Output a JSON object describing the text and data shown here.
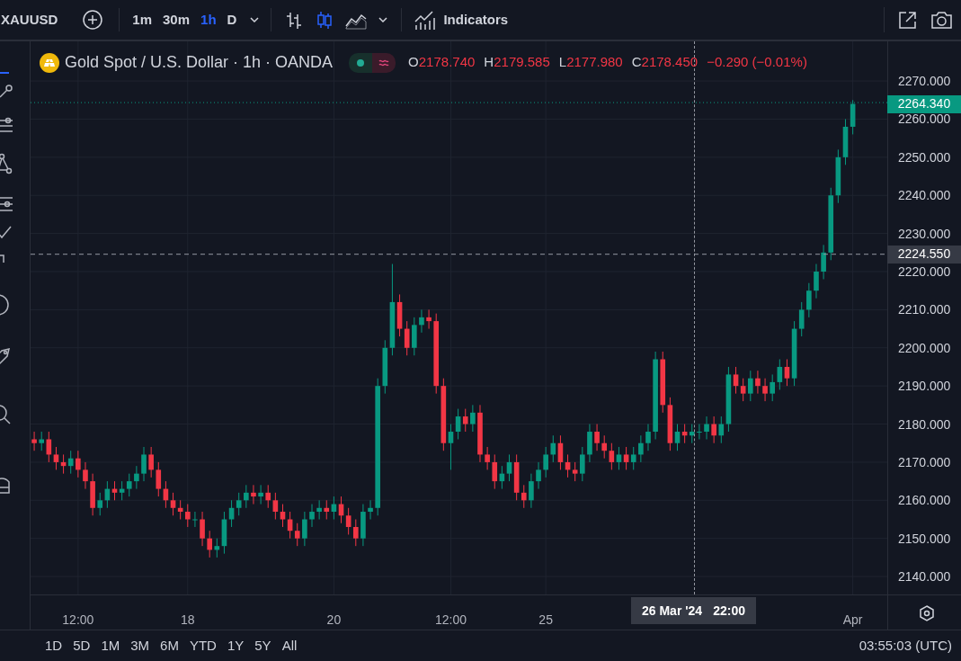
{
  "toolbar": {
    "symbol": "XAUUSD",
    "intervals": [
      {
        "label": "1m",
        "selected": false
      },
      {
        "label": "30m",
        "selected": false
      },
      {
        "label": "1h",
        "selected": true
      },
      {
        "label": "D",
        "selected": false
      }
    ],
    "chart_styles": [
      {
        "kind": "bars",
        "selected": false
      },
      {
        "kind": "candles",
        "selected": true
      },
      {
        "kind": "area",
        "selected": false
      }
    ],
    "indicators_label": "Indicators"
  },
  "legend": {
    "title": "Gold Spot / U.S. Dollar · 1h · OANDA",
    "ohlc": [
      {
        "label": "O",
        "value": "2178.740"
      },
      {
        "label": "H",
        "value": "2179.585"
      },
      {
        "label": "L",
        "value": "2177.980"
      },
      {
        "label": "C",
        "value": "2178.450"
      }
    ],
    "change": "−0.290 (−0.01%)"
  },
  "crosshair": {
    "price": "2224.550",
    "date": "26 Mar '24",
    "time": "22:00"
  },
  "last_price": "2264.340",
  "chart_data": {
    "type": "candlestick",
    "grid": true,
    "ref_lines": [
      {
        "axis": "y",
        "value": 2264.34,
        "color": "#089981"
      },
      {
        "axis": "y",
        "value": 2224.55,
        "color": "#9598a1"
      }
    ],
    "ylim": [
      2135.3,
      2280.4
    ],
    "yticks": [
      {
        "value": 2270,
        "label": "2270.000"
      },
      {
        "value": 2260,
        "label": "2260.000"
      },
      {
        "value": 2250,
        "label": "2250.000"
      },
      {
        "value": 2240,
        "label": "2240.000"
      },
      {
        "value": 2230,
        "label": "2230.000"
      },
      {
        "value": 2220,
        "label": "2220.000"
      },
      {
        "value": 2210,
        "label": "2210.000"
      },
      {
        "value": 2200,
        "label": "2200.000"
      },
      {
        "value": 2190,
        "label": "2190.000"
      },
      {
        "value": 2180,
        "label": "2180.000"
      },
      {
        "value": 2170,
        "label": "2170.000"
      },
      {
        "value": 2160,
        "label": "2160.000"
      },
      {
        "value": 2150,
        "label": "2150.000"
      },
      {
        "value": 2140,
        "label": "2140.000"
      }
    ],
    "categories": [
      null,
      null,
      null,
      null,
      null,
      null,
      "12:00",
      null,
      null,
      null,
      null,
      null,
      null,
      null,
      null,
      null,
      null,
      null,
      null,
      null,
      null,
      "18",
      null,
      null,
      null,
      null,
      null,
      null,
      null,
      null,
      null,
      null,
      null,
      null,
      null,
      null,
      null,
      null,
      null,
      null,
      null,
      "20",
      null,
      null,
      null,
      null,
      null,
      null,
      null,
      null,
      null,
      null,
      null,
      null,
      null,
      null,
      null,
      "12:00",
      null,
      null,
      null,
      null,
      null,
      null,
      null,
      null,
      null,
      null,
      null,
      null,
      "25",
      null,
      null,
      null,
      null,
      null,
      null,
      null,
      null,
      null,
      null,
      null,
      null,
      null,
      null,
      null,
      null,
      null,
      null,
      null,
      null,
      null,
      null,
      null,
      null,
      null,
      null,
      null,
      null,
      null,
      null,
      null,
      null,
      null,
      null,
      null,
      null,
      null,
      null,
      null,
      null,
      null,
      "Apr"
    ],
    "ohlc": [
      [
        2176,
        2178,
        2173,
        2175
      ],
      [
        2175,
        2178,
        2173,
        2176
      ],
      [
        2176,
        2178,
        2170,
        2172
      ],
      [
        2172,
        2174,
        2168,
        2170
      ],
      [
        2170,
        2172,
        2167,
        2169
      ],
      [
        2169,
        2173,
        2167,
        2171
      ],
      [
        2171,
        2173,
        2166,
        2168
      ],
      [
        2168,
        2170,
        2163,
        2165
      ],
      [
        2165,
        2167,
        2156,
        2158
      ],
      [
        2158,
        2162,
        2156,
        2160
      ],
      [
        2160,
        2165,
        2158,
        2163
      ],
      [
        2163,
        2165,
        2160,
        2162
      ],
      [
        2162,
        2165,
        2160,
        2163
      ],
      [
        2163,
        2167,
        2161,
        2165
      ],
      [
        2165,
        2169,
        2163,
        2167
      ],
      [
        2167,
        2174,
        2165,
        2172
      ],
      [
        2172,
        2174,
        2166,
        2168
      ],
      [
        2168,
        2170,
        2161,
        2163
      ],
      [
        2163,
        2165,
        2158,
        2160
      ],
      [
        2160,
        2162,
        2156,
        2158
      ],
      [
        2158,
        2160,
        2155,
        2157
      ],
      [
        2157,
        2159,
        2153,
        2155
      ],
      [
        2155,
        2157,
        2153,
        2155
      ],
      [
        2155,
        2157,
        2148,
        2150
      ],
      [
        2150,
        2152,
        2145,
        2147
      ],
      [
        2147,
        2150,
        2145,
        2148
      ],
      [
        2148,
        2157,
        2146,
        2155
      ],
      [
        2155,
        2160,
        2153,
        2158
      ],
      [
        2158,
        2162,
        2156,
        2160
      ],
      [
        2160,
        2164,
        2158,
        2162
      ],
      [
        2162,
        2164,
        2159,
        2161
      ],
      [
        2161,
        2164,
        2159,
        2162
      ],
      [
        2162,
        2164,
        2158,
        2160
      ],
      [
        2160,
        2162,
        2155,
        2157
      ],
      [
        2157,
        2159,
        2153,
        2155
      ],
      [
        2155,
        2157,
        2150,
        2152
      ],
      [
        2152,
        2154,
        2148,
        2150
      ],
      [
        2150,
        2157,
        2148,
        2155
      ],
      [
        2155,
        2159,
        2153,
        2157
      ],
      [
        2157,
        2160,
        2155,
        2158
      ],
      [
        2158,
        2160,
        2155,
        2157
      ],
      [
        2157,
        2161,
        2155,
        2159
      ],
      [
        2159,
        2161,
        2154,
        2156
      ],
      [
        2156,
        2158,
        2151,
        2153
      ],
      [
        2153,
        2155,
        2148,
        2150
      ],
      [
        2150,
        2159,
        2148,
        2157
      ],
      [
        2157,
        2160,
        2155,
        2158
      ],
      [
        2158,
        2192,
        2156,
        2190
      ],
      [
        2190,
        2202,
        2188,
        2200
      ],
      [
        2200,
        2222,
        2198,
        2212
      ],
      [
        2212,
        2214,
        2203,
        2205
      ],
      [
        2205,
        2207,
        2198,
        2200
      ],
      [
        2200,
        2208,
        2198,
        2206
      ],
      [
        2206,
        2210,
        2204,
        2208
      ],
      [
        2208,
        2210,
        2205,
        2207
      ],
      [
        2207,
        2209,
        2188,
        2190
      ],
      [
        2190,
        2192,
        2173,
        2175
      ],
      [
        2175,
        2180,
        2168,
        2178
      ],
      [
        2178,
        2184,
        2176,
        2182
      ],
      [
        2182,
        2184,
        2178,
        2180
      ],
      [
        2180,
        2185,
        2178,
        2183
      ],
      [
        2183,
        2185,
        2170,
        2172
      ],
      [
        2172,
        2174,
        2168,
        2170
      ],
      [
        2170,
        2172,
        2163,
        2165
      ],
      [
        2165,
        2169,
        2163,
        2167
      ],
      [
        2167,
        2172,
        2165,
        2170
      ],
      [
        2170,
        2172,
        2160,
        2162
      ],
      [
        2162,
        2164,
        2158,
        2160
      ],
      [
        2160,
        2167,
        2158,
        2165
      ],
      [
        2165,
        2170,
        2163,
        2168
      ],
      [
        2168,
        2174,
        2166,
        2172
      ],
      [
        2172,
        2177,
        2170,
        2175
      ],
      [
        2175,
        2177,
        2168,
        2170
      ],
      [
        2170,
        2172,
        2166,
        2168
      ],
      [
        2168,
        2170,
        2165,
        2167
      ],
      [
        2167,
        2174,
        2165,
        2172
      ],
      [
        2172,
        2180,
        2170,
        2178
      ],
      [
        2178,
        2180,
        2173,
        2175
      ],
      [
        2175,
        2177,
        2171,
        2173
      ],
      [
        2173,
        2175,
        2168,
        2170
      ],
      [
        2170,
        2174,
        2168,
        2172
      ],
      [
        2172,
        2174,
        2168,
        2170
      ],
      [
        2170,
        2174,
        2168,
        2172
      ],
      [
        2172,
        2177,
        2170,
        2175
      ],
      [
        2175,
        2180,
        2173,
        2178
      ],
      [
        2178,
        2199,
        2176,
        2197
      ],
      [
        2197,
        2199,
        2183,
        2185
      ],
      [
        2185,
        2187,
        2173,
        2175
      ],
      [
        2175,
        2180,
        2173,
        2178
      ],
      [
        2178,
        2180,
        2175,
        2177
      ],
      [
        2177,
        2180,
        2175,
        2178
      ],
      [
        2178,
        2180,
        2176,
        2178
      ],
      [
        2178,
        2182,
        2176,
        2180
      ],
      [
        2180,
        2182,
        2175,
        2177
      ],
      [
        2177,
        2182,
        2175,
        2180
      ],
      [
        2180,
        2195,
        2178,
        2193
      ],
      [
        2193,
        2195,
        2188,
        2190
      ],
      [
        2190,
        2192,
        2186,
        2188
      ],
      [
        2188,
        2194,
        2186,
        2192
      ],
      [
        2192,
        2194,
        2188,
        2190
      ],
      [
        2190,
        2192,
        2186,
        2188
      ],
      [
        2188,
        2193,
        2186,
        2191
      ],
      [
        2191,
        2197,
        2189,
        2195
      ],
      [
        2195,
        2197,
        2190,
        2192
      ],
      [
        2192,
        2207,
        2190,
        2205
      ],
      [
        2205,
        2212,
        2203,
        2210
      ],
      [
        2210,
        2217,
        2208,
        2215
      ],
      [
        2215,
        2222,
        2213,
        2220
      ],
      [
        2220,
        2227,
        2218,
        2225
      ],
      [
        2225,
        2242,
        2223,
        2240
      ],
      [
        2240,
        2252,
        2238,
        2250
      ],
      [
        2250,
        2260,
        2248,
        2258
      ],
      [
        2258,
        2265,
        2256,
        2264
      ]
    ]
  },
  "ranges": [
    "1D",
    "5D",
    "1M",
    "3M",
    "6M",
    "YTD",
    "1Y",
    "5Y",
    "All"
  ],
  "clock": "03:55:03 (UTC)"
}
